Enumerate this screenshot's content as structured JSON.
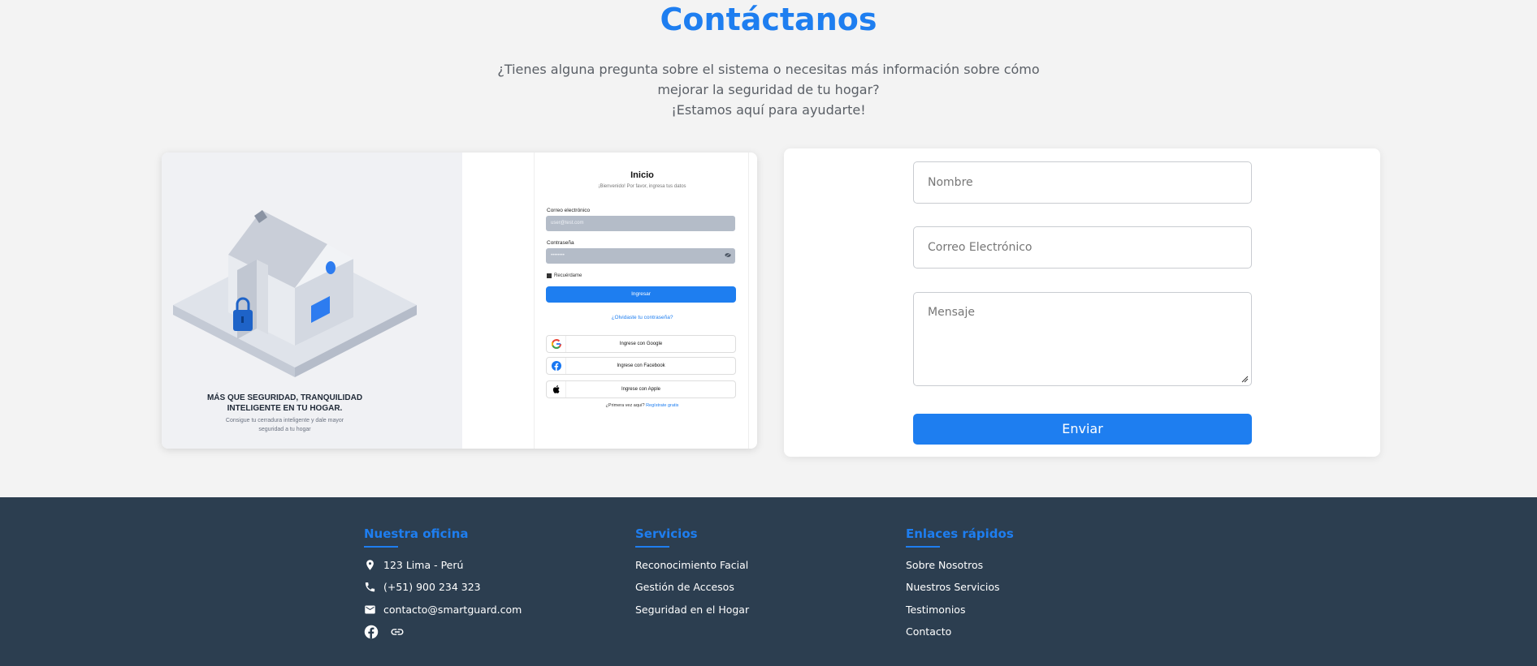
{
  "contact": {
    "title": "Contáctanos",
    "subtitle_lines": [
      "¿Tienes alguna pregunta sobre el sistema o necesitas más información sobre cómo",
      "mejorar la seguridad de tu hogar?",
      "¡Estamos aquí para ayudarte!"
    ]
  },
  "preview": {
    "promo_title_lines": [
      "MÁS QUE SEGURIDAD, TRANQUILIDAD",
      "INTELIGENTE EN TU HOGAR."
    ],
    "promo_text_lines": [
      "Consigue tu cerradura inteligente y dale mayor",
      "seguridad a tu hogar"
    ],
    "login": {
      "title": "Inicio",
      "subtitle": "¡Bienvenido! Por favor, ingresa tus datos",
      "email_label": "Correo electrónico",
      "email_value": "user@test.com",
      "password_label": "Contraseña",
      "password_value": "••••••••",
      "remember_label": "Recuérdame",
      "login_button": "Ingresar",
      "forgot_link": "¿Olvidaste tu contraseña?",
      "google_button": "Ingrese con Google",
      "facebook_button": "Ingrese con Facebook",
      "apple_button": "Ingrese con Apple",
      "signup_text": "¿Primera vez aquí?",
      "signup_link": "Regístrate gratis"
    }
  },
  "form": {
    "name_placeholder": "Nombre",
    "email_placeholder": "Correo Electrónico",
    "message_placeholder": "Mensaje",
    "submit_label": "Enviar"
  },
  "footer": {
    "office": {
      "title": "Nuestra oficina",
      "address": "123 Lima - Perú",
      "phone": "(+51) 900 234 323",
      "email": "contacto@smartguard.com"
    },
    "services": {
      "title": "Servicios",
      "items": [
        "Reconocimiento Facial",
        "Gestión de Accesos",
        "Seguridad en el Hogar"
      ]
    },
    "links": {
      "title": "Enlaces rápidos",
      "items": [
        "Sobre Nosotros",
        "Nuestros Servicios",
        "Testimonios",
        "Contacto"
      ]
    }
  },
  "colors": {
    "accent": "#1e7ef0",
    "footer_bg": "#2c3e50",
    "page_bg": "#f3f3f3"
  }
}
